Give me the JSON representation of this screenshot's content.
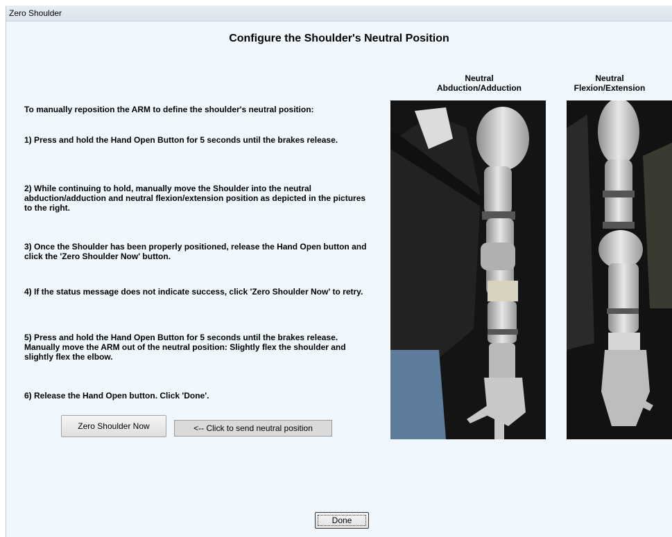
{
  "window": {
    "title": "Zero Shoulder"
  },
  "heading": "Configure the Shoulder's Neutral Position",
  "instructions": {
    "intro": "To manually reposition the ARM to define the shoulder's neutral position:",
    "steps": [
      "1)  Press and hold the Hand Open Button for 5 seconds until the brakes release.",
      "2)  While continuing to hold, manually move the Shoulder into the neutral abduction/adduction and neutral flexion/extension position as depicted in the pictures to the right.",
      "3)  Once the Shoulder has been properly positioned, release the Hand Open button and click the 'Zero Shoulder Now' button.",
      "4)  If the status message does not indicate success, click 'Zero Shoulder Now' to retry.",
      "5)  Press and hold the Hand Open Button for 5 seconds until the brakes release.  Manually move the ARM out of the neutral position: Slightly flex the shoulder and slightly flex the elbow.",
      "6)  Release the Hand Open button.  Click 'Done'."
    ]
  },
  "photos": [
    {
      "caption_line1": "Neutral",
      "caption_line2": "Abduction/Adduction"
    },
    {
      "caption_line1": "Neutral",
      "caption_line2": "Flexion/Extension"
    }
  ],
  "buttons": {
    "zero_shoulder": "Zero Shoulder Now",
    "done": "Done"
  },
  "status_message": "<-- Click to send neutral position"
}
